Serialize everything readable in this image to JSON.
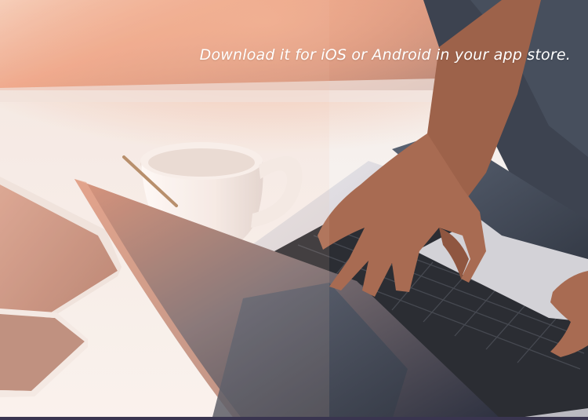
{
  "hero": {
    "caption": "Download it for iOS or Android in your app store.",
    "palette": {
      "warm_glow": "#e79a7c",
      "table_white": "#f6f2ef",
      "sleeve_dark": "#3c4452",
      "skin": "#a86b52",
      "laptop_silver": "#c8c7cc",
      "keys": "#2b2d33",
      "bar": "#3a3550"
    }
  }
}
